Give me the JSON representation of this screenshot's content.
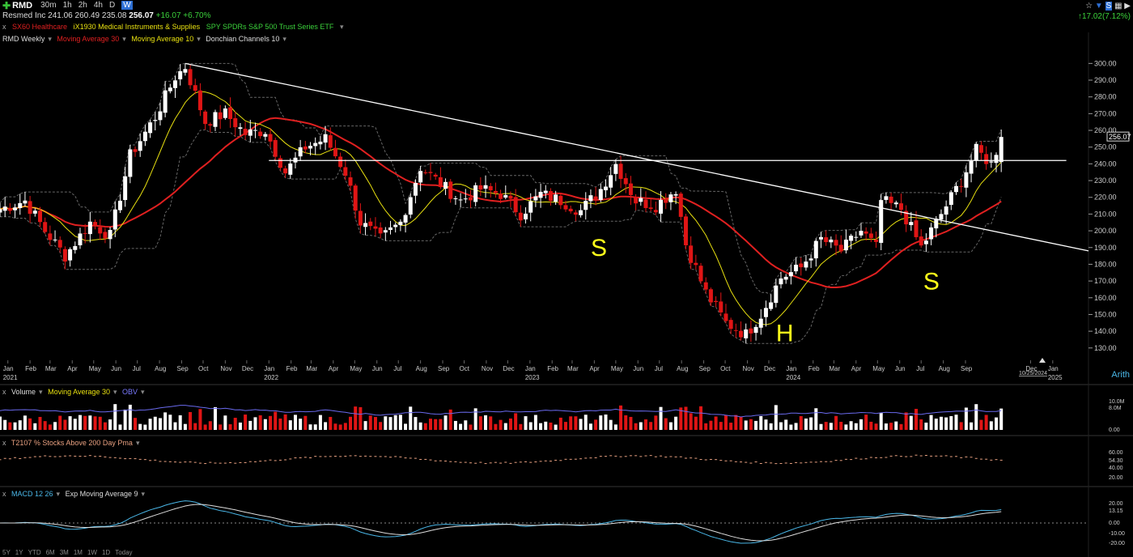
{
  "toolbar": {
    "symbol": "RMD",
    "timeframes": [
      "30m",
      "1h",
      "2h",
      "4h",
      "D",
      "W"
    ],
    "active": "W"
  },
  "quote": {
    "name": "Resmed Inc",
    "open": "241.06",
    "high": "260.49",
    "low": "235.08",
    "last": "256.07",
    "change": "+16.07",
    "change_pct": "+6.70%",
    "right_change": "17.02(7.12%)"
  },
  "related": [
    "SX60 Healthcare",
    "iX1930 Medical Instruments & Supplies",
    "SPY SPDRs S&P 500 Trust Series ETF"
  ],
  "main_panel": {
    "title": "RMD Weekly",
    "studies": [
      "Moving Average 30",
      "Moving Average 10",
      "Donchian Channels 10"
    ],
    "axis_mode": "Arith",
    "date_marker": "10/25/2024"
  },
  "volume_panel": {
    "studies": [
      "Volume",
      "Moving Average 30",
      "OBV"
    ],
    "labels": [
      "10.0M",
      "8.0M",
      "0.00"
    ]
  },
  "breadth_panel": {
    "title": "T2107 % Stocks Above 200 Day Pma",
    "labels": [
      "54.30",
      "40.00",
      "20.00"
    ],
    "top_label": "60.00"
  },
  "macd_panel": {
    "studies": [
      "MACD 12 26",
      "Exp Moving Average 9"
    ],
    "labels": [
      "20.00",
      "13.15",
      "0.00",
      "-10.00",
      "-20.00"
    ]
  },
  "bottom_bar": [
    "5Y",
    "1Y",
    "YTD",
    "6M",
    "3M",
    "1M",
    "1W",
    "1D",
    "Today"
  ],
  "colors": {
    "up": "#ffffff",
    "down": "#e01515",
    "ma30": "#e02020",
    "ma10": "#e8e010",
    "donchian": "#666666",
    "annotation": "#ffff1a"
  },
  "chart_data": {
    "type": "candlestick",
    "title": "RMD Weekly",
    "ylim": [
      127,
      305
    ],
    "y_ticks": [
      130,
      140,
      150,
      160,
      170,
      180,
      190,
      200,
      210,
      220,
      230,
      240,
      250,
      260,
      270,
      280,
      290,
      300
    ],
    "y_tick_labels": [
      "130.00",
      "140.00",
      "150.00",
      "160.00",
      "170.00",
      "180.00",
      "190.00",
      "200.00",
      "210.00",
      "220.00",
      "230.00",
      "240.00",
      "250.00",
      "260.00",
      "270.00",
      "280.00",
      "290.00",
      "300.00"
    ],
    "last_price_label": "256.07",
    "x_range": [
      "2020-12-21",
      "2025-02-20"
    ],
    "x_ticks": [
      {
        "date": "2021-01-01",
        "label": "Jan",
        "year": "2021"
      },
      {
        "date": "2021-02-01",
        "label": "Feb"
      },
      {
        "date": "2021-03-01",
        "label": "Mar"
      },
      {
        "date": "2021-04-01",
        "label": "Apr"
      },
      {
        "date": "2021-05-01",
        "label": "May"
      },
      {
        "date": "2021-06-01",
        "label": "Jun"
      },
      {
        "date": "2021-07-01",
        "label": "Jul"
      },
      {
        "date": "2021-08-01",
        "label": "Aug"
      },
      {
        "date": "2021-09-01",
        "label": "Sep"
      },
      {
        "date": "2021-10-01",
        "label": "Oct"
      },
      {
        "date": "2021-11-01",
        "label": "Nov"
      },
      {
        "date": "2021-12-01",
        "label": "Dec"
      },
      {
        "date": "2022-01-01",
        "label": "Jan",
        "year": "2022"
      },
      {
        "date": "2022-02-01",
        "label": "Feb"
      },
      {
        "date": "2022-03-01",
        "label": "Mar"
      },
      {
        "date": "2022-04-01",
        "label": "Apr"
      },
      {
        "date": "2022-05-01",
        "label": "May"
      },
      {
        "date": "2022-06-01",
        "label": "Jun"
      },
      {
        "date": "2022-07-01",
        "label": "Jul"
      },
      {
        "date": "2022-08-01",
        "label": "Aug"
      },
      {
        "date": "2022-09-01",
        "label": "Sep"
      },
      {
        "date": "2022-10-01",
        "label": "Oct"
      },
      {
        "date": "2022-11-01",
        "label": "Nov"
      },
      {
        "date": "2022-12-01",
        "label": "Dec"
      },
      {
        "date": "2023-01-01",
        "label": "Jan",
        "year": "2023"
      },
      {
        "date": "2023-02-01",
        "label": "Feb"
      },
      {
        "date": "2023-03-01",
        "label": "Mar"
      },
      {
        "date": "2023-04-01",
        "label": "Apr"
      },
      {
        "date": "2023-05-01",
        "label": "May"
      },
      {
        "date": "2023-06-01",
        "label": "Jun"
      },
      {
        "date": "2023-07-01",
        "label": "Jul"
      },
      {
        "date": "2023-08-01",
        "label": "Aug"
      },
      {
        "date": "2023-09-01",
        "label": "Sep"
      },
      {
        "date": "2023-10-01",
        "label": "Oct"
      },
      {
        "date": "2023-11-01",
        "label": "Nov"
      },
      {
        "date": "2023-12-01",
        "label": "Dec"
      },
      {
        "date": "2024-01-01",
        "label": "Jan",
        "year": "2024"
      },
      {
        "date": "2024-02-01",
        "label": "Feb"
      },
      {
        "date": "2024-03-01",
        "label": "Mar"
      },
      {
        "date": "2024-04-01",
        "label": "Apr"
      },
      {
        "date": "2024-05-01",
        "label": "May"
      },
      {
        "date": "2024-06-01",
        "label": "Jun"
      },
      {
        "date": "2024-07-01",
        "label": "Jul"
      },
      {
        "date": "2024-08-01",
        "label": "Aug"
      },
      {
        "date": "2024-09-01",
        "label": "Sep"
      },
      {
        "date": "2024-12-01",
        "label": "Dec"
      },
      {
        "date": "2025-01-01",
        "label": "Jan",
        "year": "2025"
      }
    ],
    "anchors": [
      {
        "date": "2020-12-21",
        "price": 213
      },
      {
        "date": "2021-01-25",
        "price": 218
      },
      {
        "date": "2021-02-22",
        "price": 200
      },
      {
        "date": "2021-03-22",
        "price": 185
      },
      {
        "date": "2021-04-26",
        "price": 205
      },
      {
        "date": "2021-05-24",
        "price": 197
      },
      {
        "date": "2021-06-21",
        "price": 245
      },
      {
        "date": "2021-07-26",
        "price": 268
      },
      {
        "date": "2021-08-23",
        "price": 292
      },
      {
        "date": "2021-09-06",
        "price": 298
      },
      {
        "date": "2021-10-04",
        "price": 265
      },
      {
        "date": "2021-11-01",
        "price": 270
      },
      {
        "date": "2021-11-29",
        "price": 258
      },
      {
        "date": "2021-12-27",
        "price": 260
      },
      {
        "date": "2022-01-24",
        "price": 235
      },
      {
        "date": "2022-02-21",
        "price": 250
      },
      {
        "date": "2022-03-21",
        "price": 255
      },
      {
        "date": "2022-04-18",
        "price": 235
      },
      {
        "date": "2022-05-09",
        "price": 205
      },
      {
        "date": "2022-06-06",
        "price": 195
      },
      {
        "date": "2022-07-04",
        "price": 205
      },
      {
        "date": "2022-08-01",
        "price": 238
      },
      {
        "date": "2022-08-29",
        "price": 228
      },
      {
        "date": "2022-09-26",
        "price": 218
      },
      {
        "date": "2022-10-24",
        "price": 225
      },
      {
        "date": "2022-11-21",
        "price": 222
      },
      {
        "date": "2022-12-19",
        "price": 210
      },
      {
        "date": "2023-01-16",
        "price": 222
      },
      {
        "date": "2023-02-13",
        "price": 218
      },
      {
        "date": "2023-03-13",
        "price": 212
      },
      {
        "date": "2023-04-10",
        "price": 225
      },
      {
        "date": "2023-05-01",
        "price": 240
      },
      {
        "date": "2023-05-29",
        "price": 218
      },
      {
        "date": "2023-06-26",
        "price": 215
      },
      {
        "date": "2023-07-24",
        "price": 225
      },
      {
        "date": "2023-08-07",
        "price": 192
      },
      {
        "date": "2023-09-04",
        "price": 163
      },
      {
        "date": "2023-10-02",
        "price": 145
      },
      {
        "date": "2023-10-30",
        "price": 138
      },
      {
        "date": "2023-11-20",
        "price": 150
      },
      {
        "date": "2023-12-18",
        "price": 172
      },
      {
        "date": "2024-01-15",
        "price": 178
      },
      {
        "date": "2024-02-12",
        "price": 195
      },
      {
        "date": "2024-03-11",
        "price": 188
      },
      {
        "date": "2024-04-08",
        "price": 200
      },
      {
        "date": "2024-04-29",
        "price": 190
      },
      {
        "date": "2024-05-06",
        "price": 218
      },
      {
        "date": "2024-06-03",
        "price": 213
      },
      {
        "date": "2024-07-01",
        "price": 190
      },
      {
        "date": "2024-07-29",
        "price": 210
      },
      {
        "date": "2024-08-26",
        "price": 230
      },
      {
        "date": "2024-09-16",
        "price": 248
      },
      {
        "date": "2024-10-07",
        "price": 240
      },
      {
        "date": "2024-10-21",
        "price": 256
      }
    ],
    "trendlines": [
      {
        "from": {
          "date": "2021-09-06",
          "price": 300
        },
        "to": {
          "date": "2025-02-20",
          "price": 188
        }
      },
      {
        "from": {
          "date": "2022-01-01",
          "price": 242
        },
        "to": {
          "date": "2025-01-20",
          "price": 242
        }
      }
    ],
    "annotations": [
      {
        "text": "S",
        "date": "2023-03-27",
        "price": 185
      },
      {
        "text": "H",
        "date": "2023-12-11",
        "price": 134
      },
      {
        "text": "S",
        "date": "2024-07-04",
        "price": 165
      }
    ]
  }
}
